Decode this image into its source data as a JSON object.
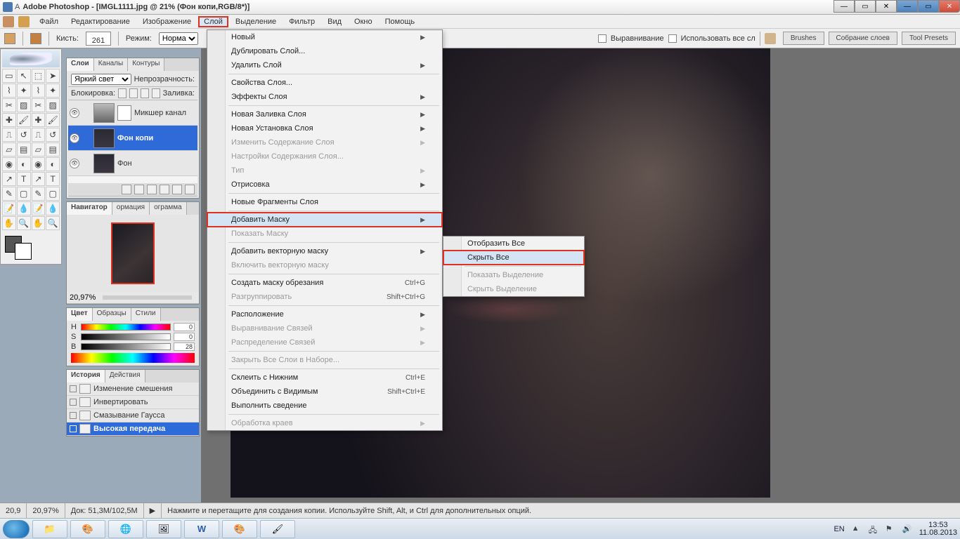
{
  "titlebar": {
    "prefix": "A",
    "text": "Adobe Photoshop - [IMGL1111.jpg @ 21% (Фон копи,RGB/8*)]"
  },
  "menubar": {
    "items": [
      "Файл",
      "Редактирование",
      "Изображение",
      "Слой",
      "Выделение",
      "Фильтр",
      "Вид",
      "Окно",
      "Помощь"
    ],
    "highlighted_index": 3
  },
  "optionsbar": {
    "brush_label": "Кисть:",
    "brush_size": "261",
    "mode_label": "Режим:",
    "mode_value": "Норма",
    "align_label": "Выравнивание",
    "use_all_label": "Использовать все сл"
  },
  "dockwells": [
    "Brushes",
    "Собрание слоев",
    "Tool Presets"
  ],
  "panels": {
    "layers": {
      "tabs": [
        "Слои",
        "Каналы",
        "Контуры"
      ],
      "blend_label": "Яркий свет",
      "opacity_label": "Непрозрачность:",
      "lock_label": "Блокировка:",
      "fill_label": "Заливка:",
      "rows": [
        {
          "name": "Микшер канал"
        },
        {
          "name": "Фон копи"
        },
        {
          "name": "Фон"
        }
      ]
    },
    "navigator": {
      "tabs": [
        "Навигатор",
        "ормация",
        "ограмма"
      ],
      "zoom": "20,97%"
    },
    "color": {
      "tabs": [
        "Цвет",
        "Образцы",
        "Стили"
      ],
      "sliders": [
        {
          "lbl": "H",
          "val": "0"
        },
        {
          "lbl": "S",
          "val": "0"
        },
        {
          "lbl": "B",
          "val": "28"
        }
      ]
    },
    "history": {
      "tabs": [
        "История",
        "Действия"
      ],
      "rows": [
        "Изменение смешения",
        "Инвертировать",
        "Смазывание Гаусса",
        "Высокая передача"
      ]
    }
  },
  "menu": {
    "items": [
      {
        "t": "Новый",
        "arrow": true
      },
      {
        "t": "Дублировать Слой..."
      },
      {
        "t": "Удалить Слой",
        "arrow": true
      },
      {
        "sep": true
      },
      {
        "t": "Свойства Слоя..."
      },
      {
        "t": "Эффекты Слоя",
        "arrow": true
      },
      {
        "sep": true
      },
      {
        "t": "Новая Заливка Слоя",
        "arrow": true
      },
      {
        "t": "Новая Установка Слоя",
        "arrow": true
      },
      {
        "t": "Изменить Содержание Слоя",
        "arrow": true,
        "disabled": true
      },
      {
        "t": "Настройки Содержания Слоя...",
        "disabled": true
      },
      {
        "t": "Тип",
        "arrow": true,
        "disabled": true
      },
      {
        "t": "Отрисовка",
        "arrow": true
      },
      {
        "sep": true
      },
      {
        "t": "Новые Фрагменты Слоя"
      },
      {
        "sep": true
      },
      {
        "t": "Добавить Маску",
        "arrow": true,
        "hover": true,
        "hl": true
      },
      {
        "t": "Показать Маску",
        "disabled": true
      },
      {
        "sep": true
      },
      {
        "t": "Добавить векторную маску",
        "arrow": true
      },
      {
        "t": "Включить векторную маску",
        "disabled": true
      },
      {
        "sep": true
      },
      {
        "t": "Создать маску обрезания",
        "short": "Ctrl+G"
      },
      {
        "t": "Разгруппировать",
        "short": "Shift+Ctrl+G",
        "disabled": true
      },
      {
        "sep": true
      },
      {
        "t": "Расположение",
        "arrow": true
      },
      {
        "t": "Выравнивание Связей",
        "arrow": true,
        "disabled": true
      },
      {
        "t": "Распределение Связей",
        "arrow": true,
        "disabled": true
      },
      {
        "sep": true
      },
      {
        "t": "Закрыть Все Слои в Наборе...",
        "disabled": true
      },
      {
        "sep": true
      },
      {
        "t": "Склеить с Нижним",
        "short": "Ctrl+E"
      },
      {
        "t": "Объединить с Видимым",
        "short": "Shift+Ctrl+E"
      },
      {
        "t": "Выполнить сведение"
      },
      {
        "sep": true
      },
      {
        "t": "Обработка краев",
        "arrow": true,
        "disabled": true
      }
    ]
  },
  "submenu": {
    "items": [
      {
        "t": "Отобразить Все"
      },
      {
        "t": "Скрыть Все",
        "hover": true,
        "hl": true
      },
      {
        "sep": true
      },
      {
        "t": "Показать Выделение",
        "disabled": true
      },
      {
        "t": "Скрыть Выделение",
        "disabled": true
      }
    ]
  },
  "status": {
    "zoom1": "20,9",
    "zoom2": "20,97%",
    "doc": "Док: 51,3M/102,5M",
    "hint": "Нажмите и перетащите для создания копии.  Используйте Shift, Alt, и Ctrl для дополнительных опций."
  },
  "taskbar": {
    "lang": "EN",
    "time": "13:53",
    "date": "11.08.2013"
  }
}
